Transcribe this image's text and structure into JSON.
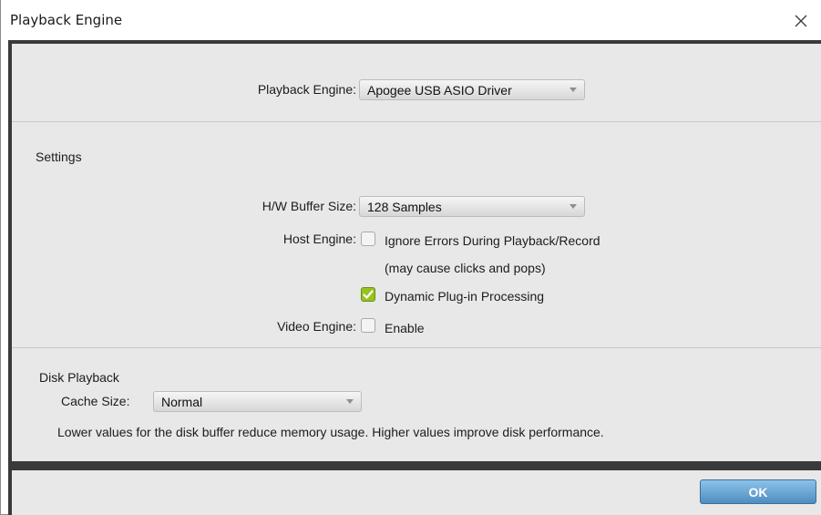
{
  "window": {
    "title": "Playback Engine",
    "close_icon": "close-icon"
  },
  "engine": {
    "label": "Playback Engine:",
    "value": "Apogee USB ASIO Driver"
  },
  "settings": {
    "heading": "Settings",
    "buffer": {
      "label": "H/W Buffer Size:",
      "value": "128 Samples"
    },
    "host_engine": {
      "label": "Host Engine:",
      "ignore_errors": {
        "label": "Ignore Errors During Playback/Record",
        "checked": false
      },
      "note": "(may cause clicks and pops)",
      "dynamic": {
        "label": "Dynamic Plug-in Processing",
        "checked": true
      }
    },
    "video": {
      "label": "Video Engine:",
      "option": "Enable",
      "checked": false
    }
  },
  "disk": {
    "heading": "Disk Playback",
    "cache": {
      "label": "Cache Size:",
      "value": "Normal"
    },
    "description": "Lower values for the disk buffer reduce memory usage.  Higher values improve disk performance."
  },
  "footer": {
    "ok_label": "OK"
  },
  "colors": {
    "accent_green": "#96c31e",
    "ok_blue": "#4f8dc0",
    "dark_frame": "#3a3a3a",
    "panel_bg": "#e8e8e8"
  }
}
